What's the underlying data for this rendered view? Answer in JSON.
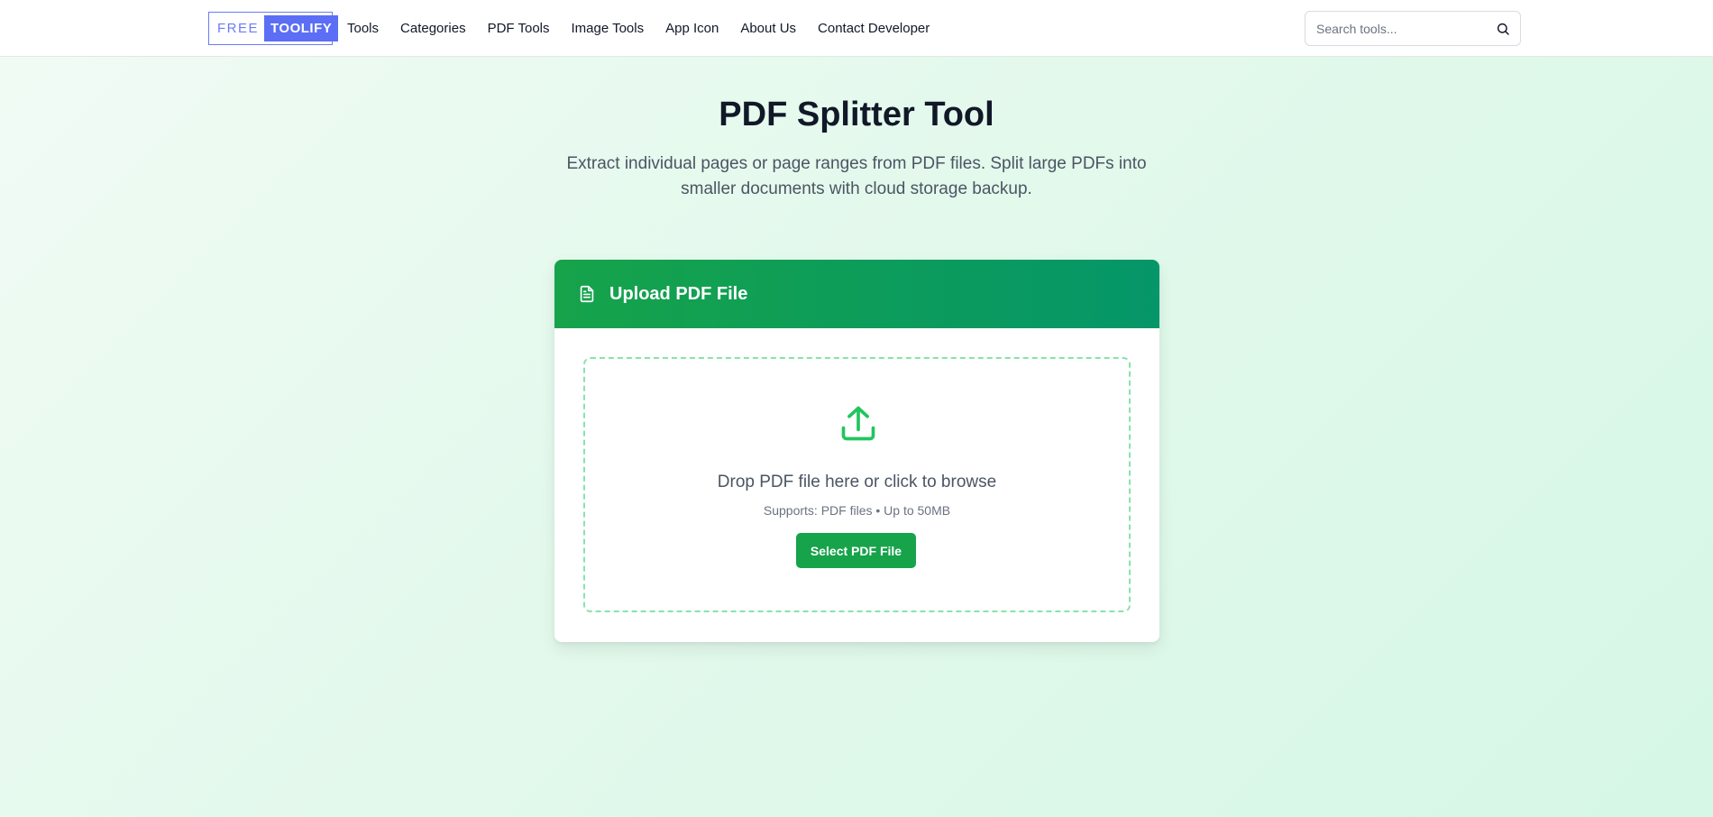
{
  "header": {
    "logo": {
      "part1": "FREE",
      "part2": "TOOLIFY"
    },
    "nav": [
      "Tools",
      "Categories",
      "PDF Tools",
      "Image Tools",
      "App Icon",
      "About Us",
      "Contact Developer"
    ],
    "search": {
      "placeholder": "Search tools...",
      "icon": "search-icon"
    }
  },
  "hero": {
    "title": "PDF Splitter Tool",
    "subtitle": "Extract individual pages or page ranges from PDF files. Split large PDFs into smaller documents with cloud storage backup."
  },
  "upload_card": {
    "title": "Upload PDF File",
    "header_icon": "document-icon",
    "dropzone_icon": "upload-icon",
    "drop_text": "Drop PDF file here or click to browse",
    "supports_text": "Supports: PDF files • Up to 50MB",
    "button_label": "Select PDF File"
  },
  "colors": {
    "accent": "#16a34a",
    "accent_dark": "#059669",
    "logo_blue": "#5b6ef5",
    "dropzone_border": "#86e4a9"
  }
}
